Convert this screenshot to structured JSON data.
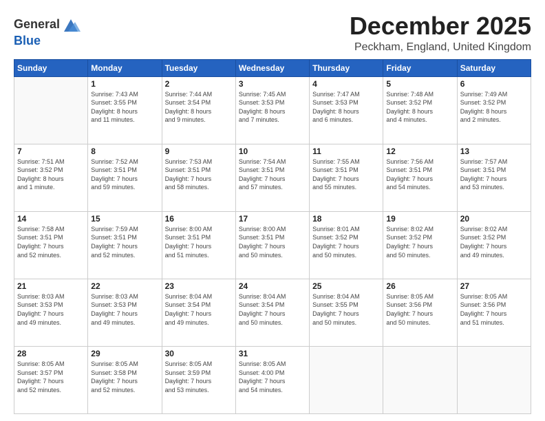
{
  "header": {
    "logo_line1": "General",
    "logo_line2": "Blue",
    "title": "December 2025",
    "subtitle": "Peckham, England, United Kingdom"
  },
  "weekdays": [
    "Sunday",
    "Monday",
    "Tuesday",
    "Wednesday",
    "Thursday",
    "Friday",
    "Saturday"
  ],
  "weeks": [
    [
      {
        "day": "",
        "info": ""
      },
      {
        "day": "1",
        "info": "Sunrise: 7:43 AM\nSunset: 3:55 PM\nDaylight: 8 hours\nand 11 minutes."
      },
      {
        "day": "2",
        "info": "Sunrise: 7:44 AM\nSunset: 3:54 PM\nDaylight: 8 hours\nand 9 minutes."
      },
      {
        "day": "3",
        "info": "Sunrise: 7:45 AM\nSunset: 3:53 PM\nDaylight: 8 hours\nand 7 minutes."
      },
      {
        "day": "4",
        "info": "Sunrise: 7:47 AM\nSunset: 3:53 PM\nDaylight: 8 hours\nand 6 minutes."
      },
      {
        "day": "5",
        "info": "Sunrise: 7:48 AM\nSunset: 3:52 PM\nDaylight: 8 hours\nand 4 minutes."
      },
      {
        "day": "6",
        "info": "Sunrise: 7:49 AM\nSunset: 3:52 PM\nDaylight: 8 hours\nand 2 minutes."
      }
    ],
    [
      {
        "day": "7",
        "info": "Sunrise: 7:51 AM\nSunset: 3:52 PM\nDaylight: 8 hours\nand 1 minute."
      },
      {
        "day": "8",
        "info": "Sunrise: 7:52 AM\nSunset: 3:51 PM\nDaylight: 7 hours\nand 59 minutes."
      },
      {
        "day": "9",
        "info": "Sunrise: 7:53 AM\nSunset: 3:51 PM\nDaylight: 7 hours\nand 58 minutes."
      },
      {
        "day": "10",
        "info": "Sunrise: 7:54 AM\nSunset: 3:51 PM\nDaylight: 7 hours\nand 57 minutes."
      },
      {
        "day": "11",
        "info": "Sunrise: 7:55 AM\nSunset: 3:51 PM\nDaylight: 7 hours\nand 55 minutes."
      },
      {
        "day": "12",
        "info": "Sunrise: 7:56 AM\nSunset: 3:51 PM\nDaylight: 7 hours\nand 54 minutes."
      },
      {
        "day": "13",
        "info": "Sunrise: 7:57 AM\nSunset: 3:51 PM\nDaylight: 7 hours\nand 53 minutes."
      }
    ],
    [
      {
        "day": "14",
        "info": "Sunrise: 7:58 AM\nSunset: 3:51 PM\nDaylight: 7 hours\nand 52 minutes."
      },
      {
        "day": "15",
        "info": "Sunrise: 7:59 AM\nSunset: 3:51 PM\nDaylight: 7 hours\nand 52 minutes."
      },
      {
        "day": "16",
        "info": "Sunrise: 8:00 AM\nSunset: 3:51 PM\nDaylight: 7 hours\nand 51 minutes."
      },
      {
        "day": "17",
        "info": "Sunrise: 8:00 AM\nSunset: 3:51 PM\nDaylight: 7 hours\nand 50 minutes."
      },
      {
        "day": "18",
        "info": "Sunrise: 8:01 AM\nSunset: 3:52 PM\nDaylight: 7 hours\nand 50 minutes."
      },
      {
        "day": "19",
        "info": "Sunrise: 8:02 AM\nSunset: 3:52 PM\nDaylight: 7 hours\nand 50 minutes."
      },
      {
        "day": "20",
        "info": "Sunrise: 8:02 AM\nSunset: 3:52 PM\nDaylight: 7 hours\nand 49 minutes."
      }
    ],
    [
      {
        "day": "21",
        "info": "Sunrise: 8:03 AM\nSunset: 3:53 PM\nDaylight: 7 hours\nand 49 minutes."
      },
      {
        "day": "22",
        "info": "Sunrise: 8:03 AM\nSunset: 3:53 PM\nDaylight: 7 hours\nand 49 minutes."
      },
      {
        "day": "23",
        "info": "Sunrise: 8:04 AM\nSunset: 3:54 PM\nDaylight: 7 hours\nand 49 minutes."
      },
      {
        "day": "24",
        "info": "Sunrise: 8:04 AM\nSunset: 3:54 PM\nDaylight: 7 hours\nand 50 minutes."
      },
      {
        "day": "25",
        "info": "Sunrise: 8:04 AM\nSunset: 3:55 PM\nDaylight: 7 hours\nand 50 minutes."
      },
      {
        "day": "26",
        "info": "Sunrise: 8:05 AM\nSunset: 3:56 PM\nDaylight: 7 hours\nand 50 minutes."
      },
      {
        "day": "27",
        "info": "Sunrise: 8:05 AM\nSunset: 3:56 PM\nDaylight: 7 hours\nand 51 minutes."
      }
    ],
    [
      {
        "day": "28",
        "info": "Sunrise: 8:05 AM\nSunset: 3:57 PM\nDaylight: 7 hours\nand 52 minutes."
      },
      {
        "day": "29",
        "info": "Sunrise: 8:05 AM\nSunset: 3:58 PM\nDaylight: 7 hours\nand 52 minutes."
      },
      {
        "day": "30",
        "info": "Sunrise: 8:05 AM\nSunset: 3:59 PM\nDaylight: 7 hours\nand 53 minutes."
      },
      {
        "day": "31",
        "info": "Sunrise: 8:05 AM\nSunset: 4:00 PM\nDaylight: 7 hours\nand 54 minutes."
      },
      {
        "day": "",
        "info": ""
      },
      {
        "day": "",
        "info": ""
      },
      {
        "day": "",
        "info": ""
      }
    ]
  ]
}
